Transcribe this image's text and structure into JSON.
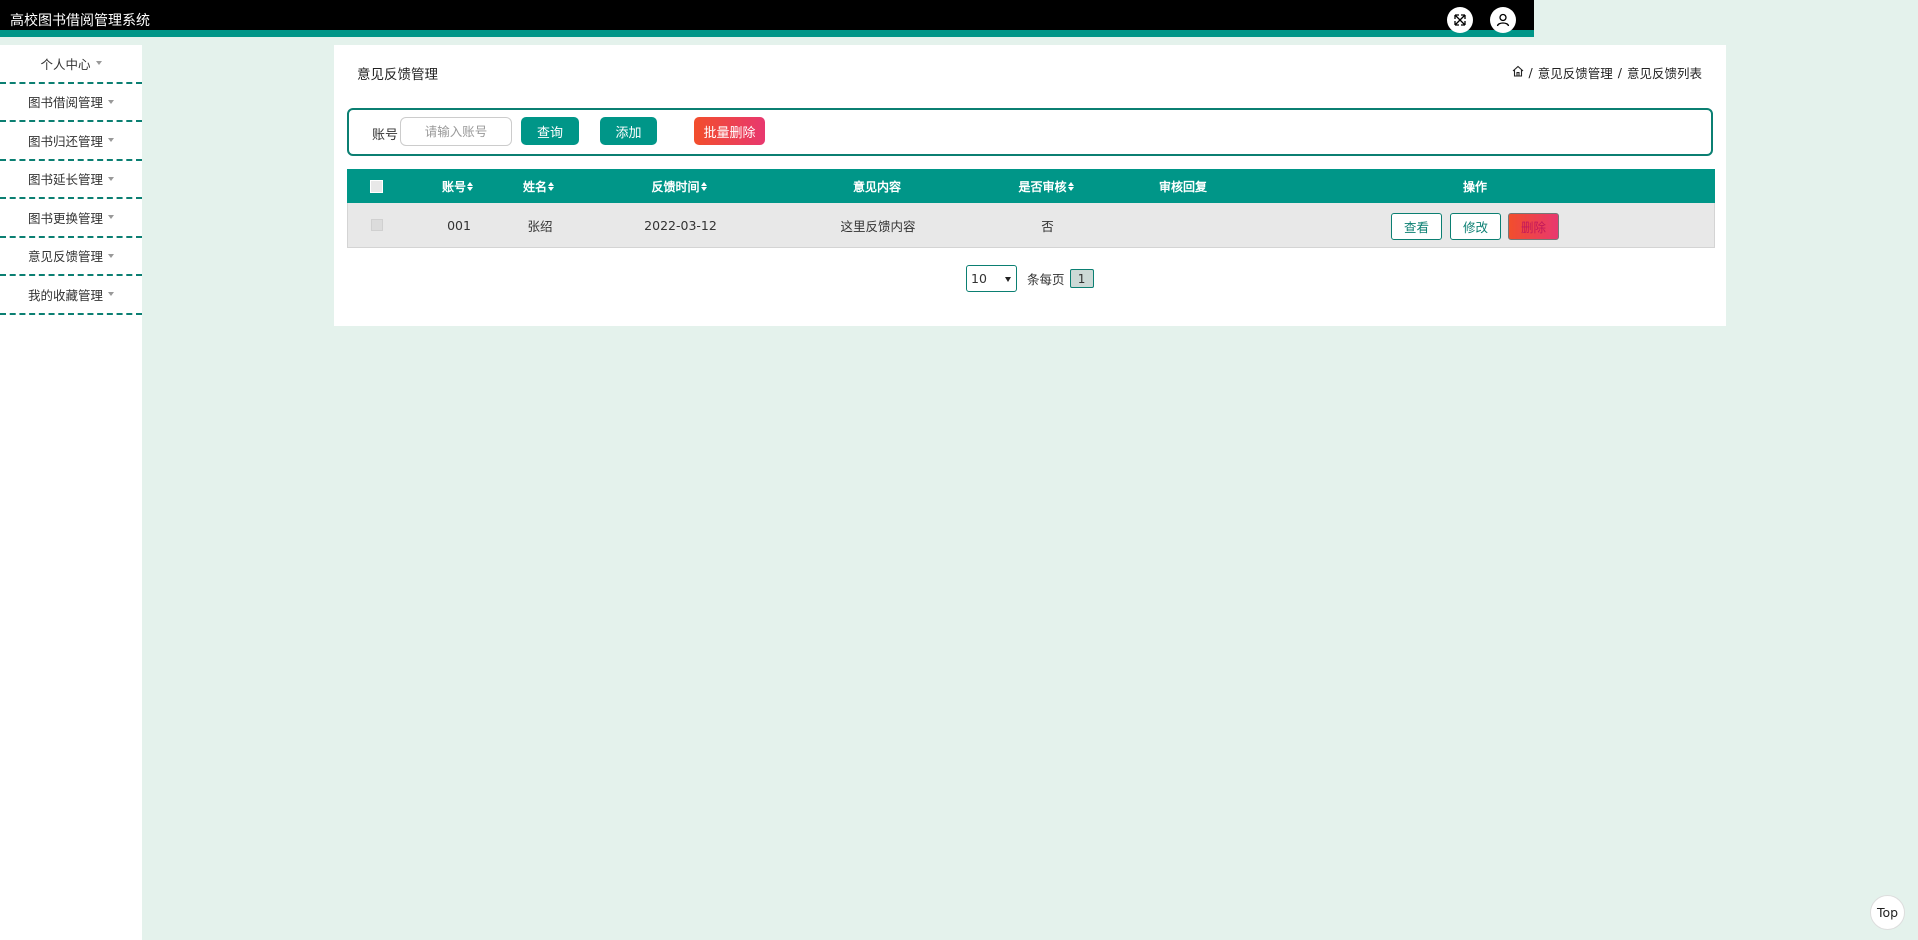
{
  "app": {
    "title": "高校图书借阅管理系统"
  },
  "topbar": {
    "fullscreen_icon": "fullscreen-icon",
    "user_icon": "user-icon"
  },
  "sidebar": {
    "items": [
      {
        "label": "个人中心"
      },
      {
        "label": "图书借阅管理"
      },
      {
        "label": "图书归还管理"
      },
      {
        "label": "图书延长管理"
      },
      {
        "label": "图书更换管理"
      },
      {
        "label": "意见反馈管理"
      },
      {
        "label": "我的收藏管理"
      }
    ]
  },
  "page": {
    "title": "意见反馈管理"
  },
  "breadcrumb": {
    "home_icon": "home-icon",
    "separator": "/",
    "level1": "意见反馈管理",
    "level2": "意见反馈列表"
  },
  "search": {
    "label": "账号",
    "placeholder": "请输入账号",
    "value": "",
    "query_label": "查询",
    "add_label": "添加",
    "batch_delete_label": "批量删除"
  },
  "table": {
    "headers": {
      "account": "账号",
      "name": "姓名",
      "time": "反馈时间",
      "content": "意见内容",
      "reviewed": "是否审核",
      "reply": "审核回复",
      "actions": "操作"
    },
    "rows": [
      {
        "account": "001",
        "name": "张绍",
        "time": "2022-03-12",
        "content": "这里反馈内容",
        "reviewed": "否",
        "reply": ""
      }
    ],
    "action_labels": {
      "view": "查看",
      "edit": "修改",
      "delete": "删除"
    }
  },
  "pagination": {
    "page_size": "10",
    "per_page_label": "条每页",
    "current_page": "1"
  },
  "back_to_top": {
    "label": "Top"
  },
  "colors": {
    "primary": "#009688",
    "border": "#0b7f72",
    "danger_start": "#f24e2c",
    "danger_end": "#e8386f",
    "background": "#e4f2ec"
  }
}
